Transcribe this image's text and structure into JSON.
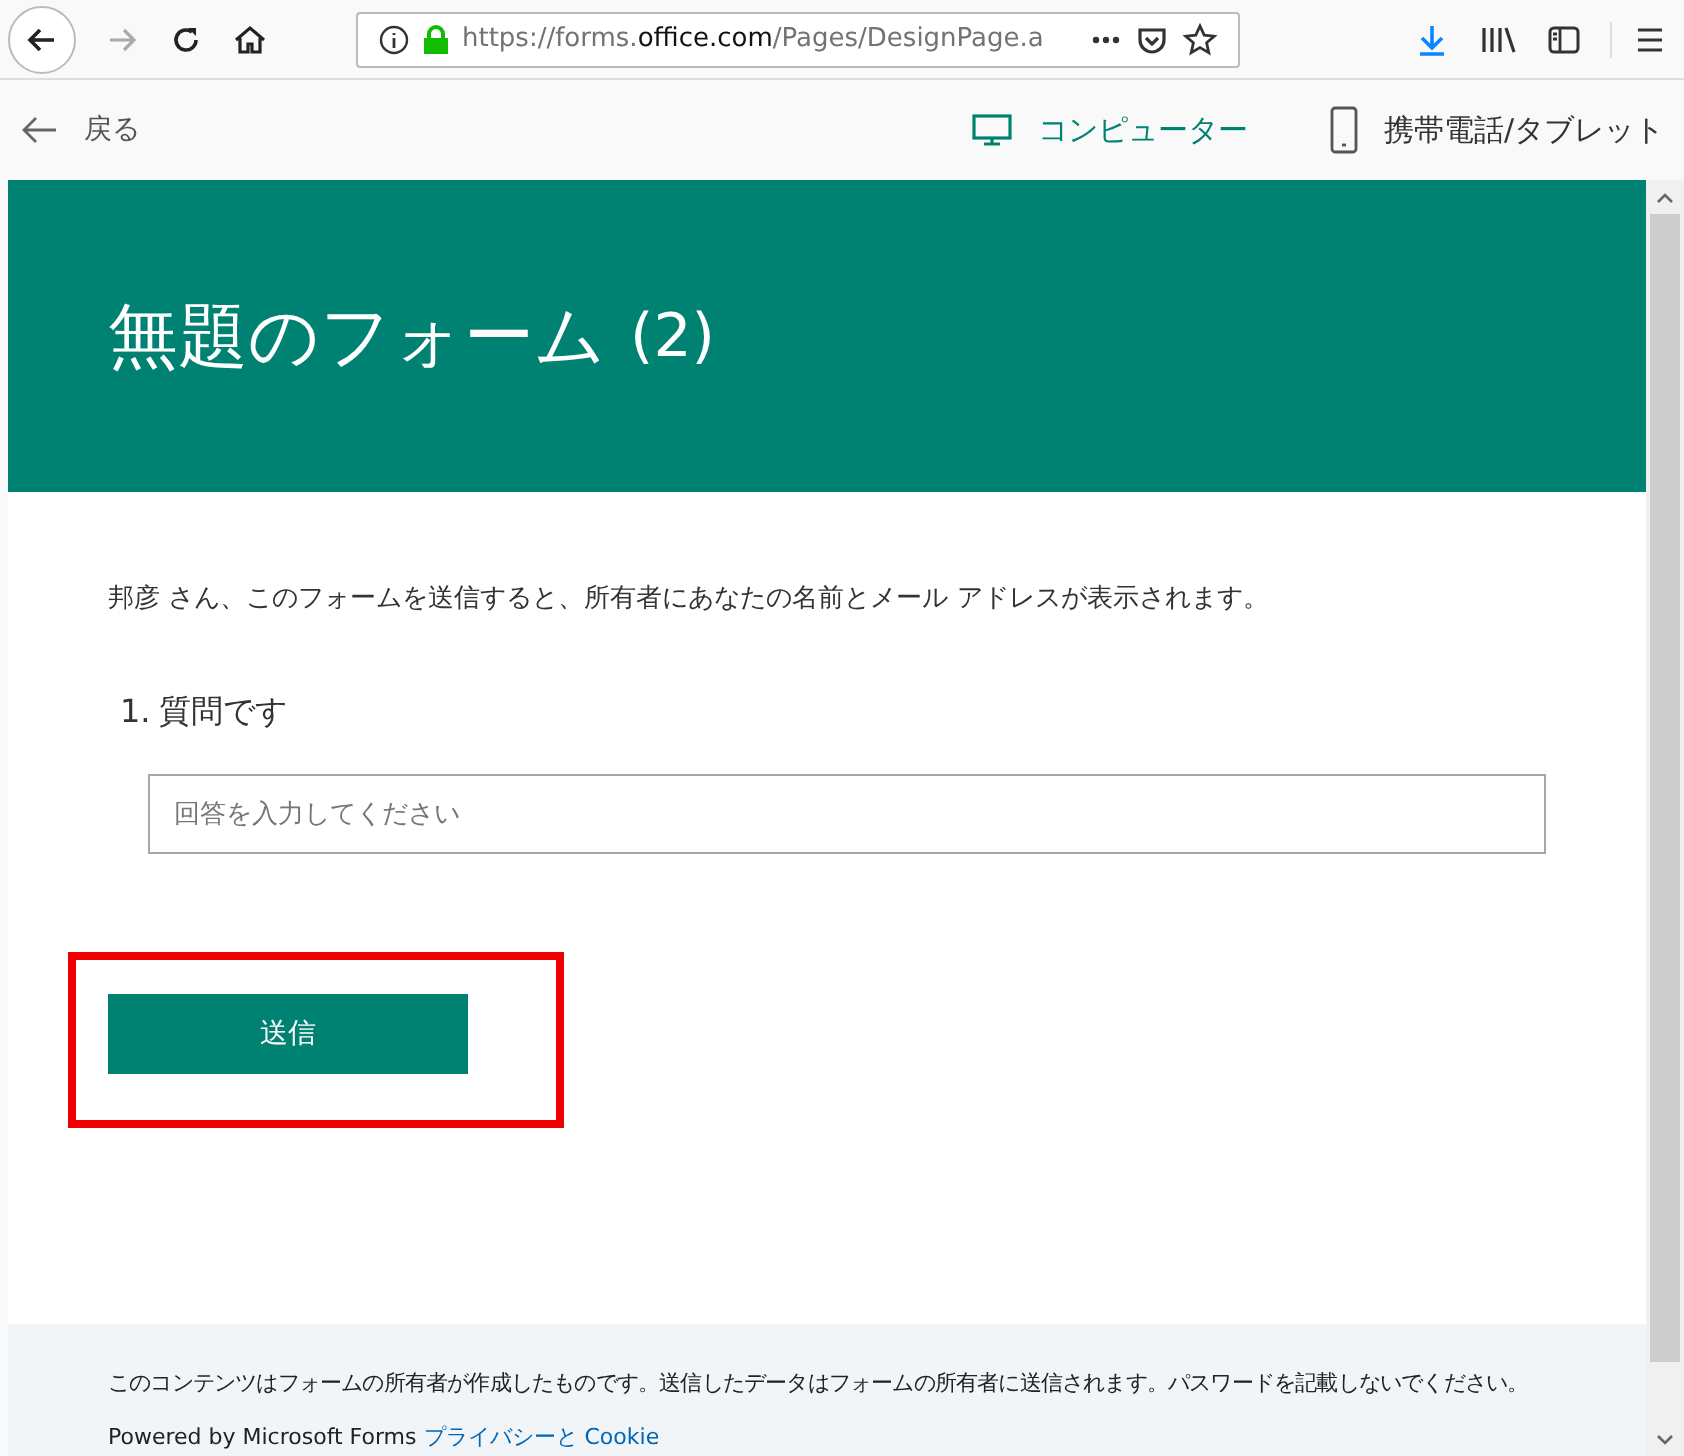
{
  "browser": {
    "url_prefix": "https://forms.",
    "url_domain": "office.com",
    "url_path": "/Pages/DesignPage.a"
  },
  "nav": {
    "back_label": "戻る",
    "modes": [
      {
        "label": "コンピューター",
        "kind": "computer",
        "selected": true
      },
      {
        "label": "携帯電話/タブレット",
        "kind": "phone",
        "selected": false
      }
    ]
  },
  "form": {
    "title": "無題のフォーム",
    "title_suffix": "(2)",
    "notice": "邦彦 さん、このフォームを送信すると、所有者にあなたの名前とメール アドレスが表示されます。",
    "questions": [
      {
        "number": "1.",
        "text": "質問です",
        "placeholder": "回答を入力してください"
      }
    ],
    "submit_label": "送信",
    "submit_highlighted": true
  },
  "footer": {
    "disclaimer": "このコンテンツはフォームの所有者が作成したものです。送信したデータはフォームの所有者に送信されます。パスワードを記載しないでください。",
    "powered": "Powered by Microsoft Forms",
    "privacy_link": "プライバシーと Cookie"
  }
}
